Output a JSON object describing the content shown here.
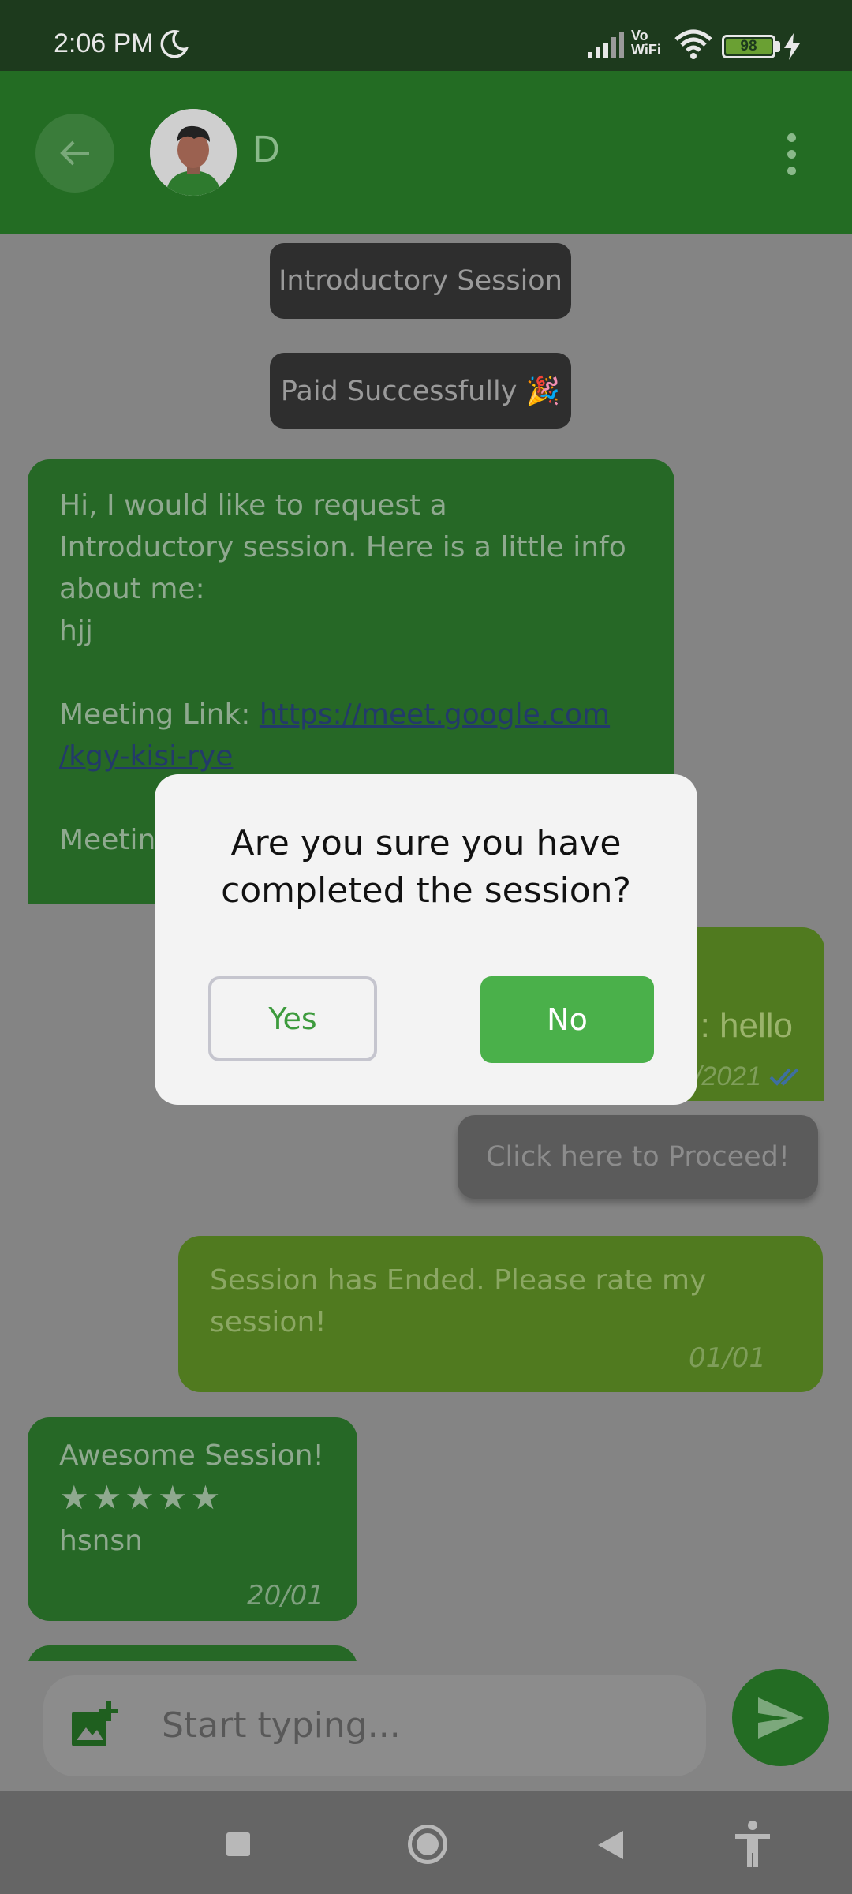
{
  "status": {
    "time": "2:06 PM",
    "vowifi_top": "Vo",
    "vowifi_bottom": "WiFi",
    "battery": "98"
  },
  "header": {
    "contact_name": "D"
  },
  "system_messages": {
    "session_type": "Introductory Session",
    "payment": "Paid Successfully 🎉"
  },
  "messages": {
    "received_1": {
      "line1": "Hi, I would like to request a",
      "line2": "Introductory session. Here is a little info",
      "line3": "about me:",
      "line4": "hjj",
      "link_label": "Meeting Link: ",
      "link_part1": "https://meet.google.com",
      "link_part2": "/kgy-kisi-rye",
      "meeting_partial": "Meetin"
    },
    "sent_1": {
      "text_partial": ": hello",
      "time_partial": "/2021"
    },
    "proceed_label": "Click here to Proceed!",
    "sent_2": {
      "line1": "Session has Ended. Please rate my",
      "line2": "session!",
      "time": "01/01"
    },
    "review": {
      "title": "Awesome Session!",
      "stars": "★★★★★",
      "rating": 5,
      "text": "hsnsn",
      "time": "20/01"
    }
  },
  "composer": {
    "placeholder": "Start typing..."
  },
  "dialog": {
    "line1": "Are you sure you have",
    "line2": "completed the session?",
    "yes_label": "Yes",
    "no_label": "No"
  },
  "colors": {
    "primary_green": "#4ab04a",
    "app_bar": "#236c23"
  }
}
